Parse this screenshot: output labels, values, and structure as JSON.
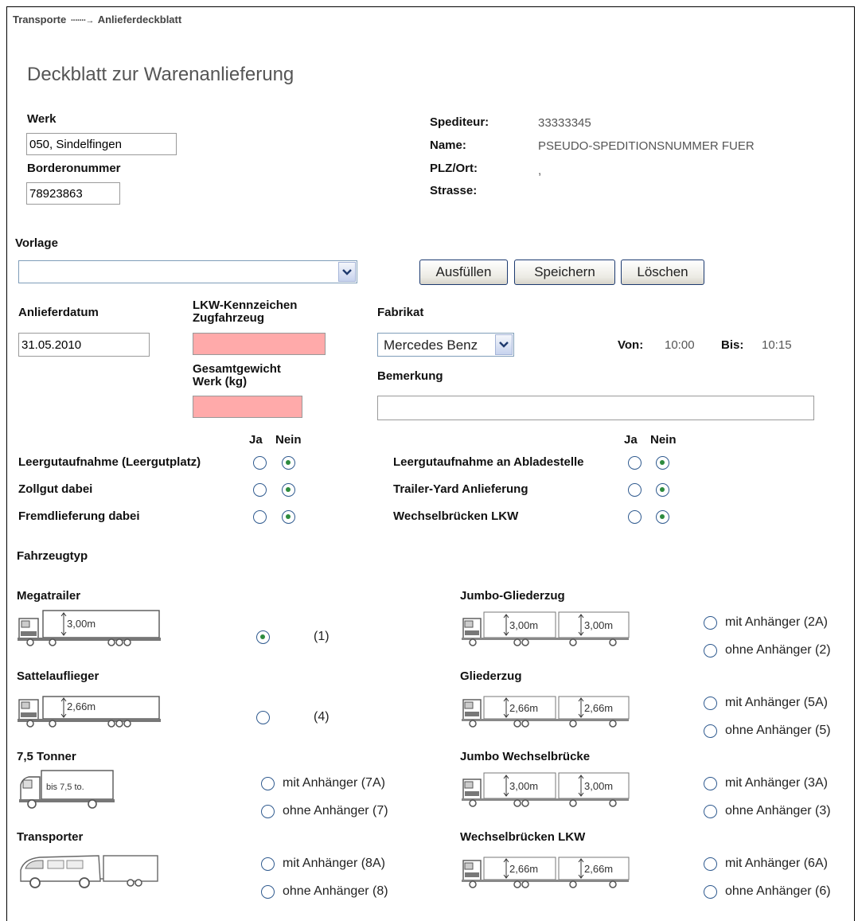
{
  "breadcrumb": {
    "parent": "Transporte",
    "current": "Anlieferdeckblatt"
  },
  "page_title": "Deckblatt zur Warenanlieferung",
  "werk": {
    "label": "Werk",
    "value": "050, Sindelfingen"
  },
  "borderonummer": {
    "label": "Borderonummer",
    "value": "78923863"
  },
  "spediteur": {
    "spediteur_label": "Spediteur:",
    "spediteur_value": "33333345",
    "name_label": "Name:",
    "name_value": "PSEUDO-SPEDITIONSNUMMER FUER",
    "plz_label": "PLZ/Ort:",
    "plz_value": ",",
    "strasse_label": "Strasse:",
    "strasse_value": ""
  },
  "vorlage": {
    "label": "Vorlage",
    "value": "",
    "buttons": {
      "fill": "Ausfüllen",
      "save": "Speichern",
      "delete": "Löschen"
    }
  },
  "delivery": {
    "date_label": "Anlieferdatum",
    "date_value": "31.05.2010",
    "plate_label_1": "LKW-Kennzeichen",
    "plate_label_2": "Zugfahrzeug",
    "plate_value": "",
    "weight_label_1": "Gesamtgewicht",
    "weight_label_2": "Werk (kg)",
    "weight_value": "",
    "fabrikat_label": "Fabrikat",
    "fabrikat_value": "Mercedes Benz",
    "von_label": "Von:",
    "von_value": "10:00",
    "bis_label": "Bis:",
    "bis_value": "10:15",
    "bemerkung_label": "Bemerkung",
    "bemerkung_value": ""
  },
  "yes_no": {
    "ja": "Ja",
    "nein": "Nein"
  },
  "options_left": [
    {
      "label": "Leergutaufnahme (Leergutplatz)",
      "selected": "nein"
    },
    {
      "label": "Zollgut dabei",
      "selected": "nein"
    },
    {
      "label": "Fremdlieferung dabei",
      "selected": "nein"
    }
  ],
  "options_right": [
    {
      "label": "Leergutaufnahme an Abladestelle",
      "selected": "nein"
    },
    {
      "label": "Trailer-Yard Anlieferung",
      "selected": "nein"
    },
    {
      "label": "Wechselbrücken LKW",
      "selected": "nein"
    }
  ],
  "fahrzeugtyp": {
    "label": "Fahrzeugtyp",
    "megatrailer": {
      "name": "Megatrailer",
      "height": "3,00m",
      "option": "(1)",
      "selected": true
    },
    "sattelauflieger": {
      "name": "Sattelauflieger",
      "height": "2,66m",
      "option": "(4)",
      "selected": false
    },
    "tonner": {
      "name": "7,5 Tonner",
      "box_text": "bis 7,5 to.",
      "with": "mit Anhänger (7A)",
      "without": "ohne Anhänger (7)"
    },
    "transporter": {
      "name": "Transporter",
      "with": "mit Anhänger (8A)",
      "without": "ohne Anhänger (8)"
    },
    "jumbo_gliederzug": {
      "name": "Jumbo-Gliederzug",
      "height_a": "3,00m",
      "height_b": "3,00m",
      "with": "mit Anhänger (2A)",
      "without": "ohne Anhänger (2)"
    },
    "gliederzug": {
      "name": "Gliederzug",
      "height_a": "2,66m",
      "height_b": "2,66m",
      "with": "mit Anhänger (5A)",
      "without": "ohne Anhänger (5)"
    },
    "jumbo_wechsel": {
      "name": "Jumbo Wechselbrücke",
      "height_a": "3,00m",
      "height_b": "3,00m",
      "with": "mit Anhänger (3A)",
      "without": "ohne Anhänger (3)"
    },
    "wechsel_lkw": {
      "name": "Wechselbrücken LKW",
      "height_a": "2,66m",
      "height_b": "2,66m",
      "with": "mit Anhänger (6A)",
      "without": "ohne Anhänger (6)"
    }
  },
  "colors": {
    "required_field": "#ffaaaa",
    "radio_checked": "#2e8b3e",
    "radio_border": "#2f5a8f"
  }
}
